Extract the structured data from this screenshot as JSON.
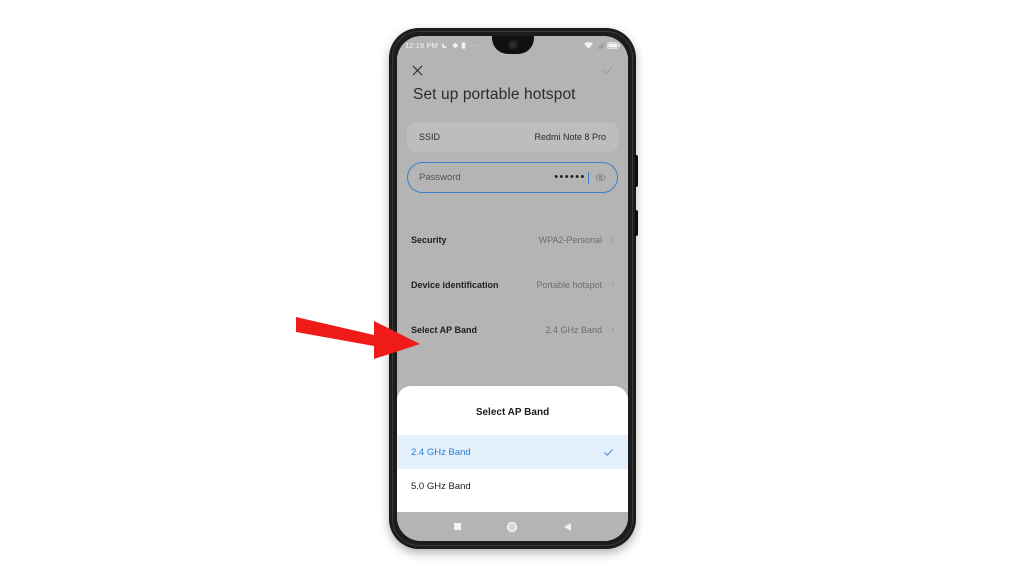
{
  "status_bar": {
    "clock": "12:19 PM",
    "left_icons": [
      "moon-icon",
      "gear-icon",
      "battery-saver-icon",
      "more-dots-icon"
    ],
    "overflow_dots": "···",
    "right_icons": [
      "wifi-icon",
      "signal-icon",
      "battery-icon"
    ]
  },
  "action_bar": {
    "close_label": "✕",
    "confirm_label": "✓"
  },
  "page": {
    "title": "Set up portable hotspot"
  },
  "ssid": {
    "label": "SSID",
    "value": "Redmi Note 8 Pro"
  },
  "password": {
    "placeholder": "Password",
    "masked_value": "••••••",
    "visibility_icon": "eye-icon"
  },
  "settings": {
    "rows": [
      {
        "label": "Security",
        "value": "WPA2-Personal"
      },
      {
        "label": "Device identification",
        "value": "Portable hotspot"
      },
      {
        "label": "Select AP Band",
        "value": "2.4 GHz Band"
      }
    ]
  },
  "dialog": {
    "title": "Select AP Band",
    "options": [
      {
        "label": "2.4 GHz Band",
        "selected": true
      },
      {
        "label": "5.0 GHz Band",
        "selected": false
      }
    ]
  },
  "nav_bar": {
    "recents": "recents-square",
    "home": "home-circle",
    "back": "back-triangle"
  },
  "annotation": {
    "type": "arrow",
    "direction": "right",
    "color": "#ee1b18",
    "points_at": "Select AP Band"
  },
  "colors": {
    "screen_dim": "#b4b4b4",
    "card": "#bdbdbd",
    "accent_blue": "#2b7fd4",
    "selected_row": "#e4f0fb",
    "frame": "#1c1c1c"
  }
}
